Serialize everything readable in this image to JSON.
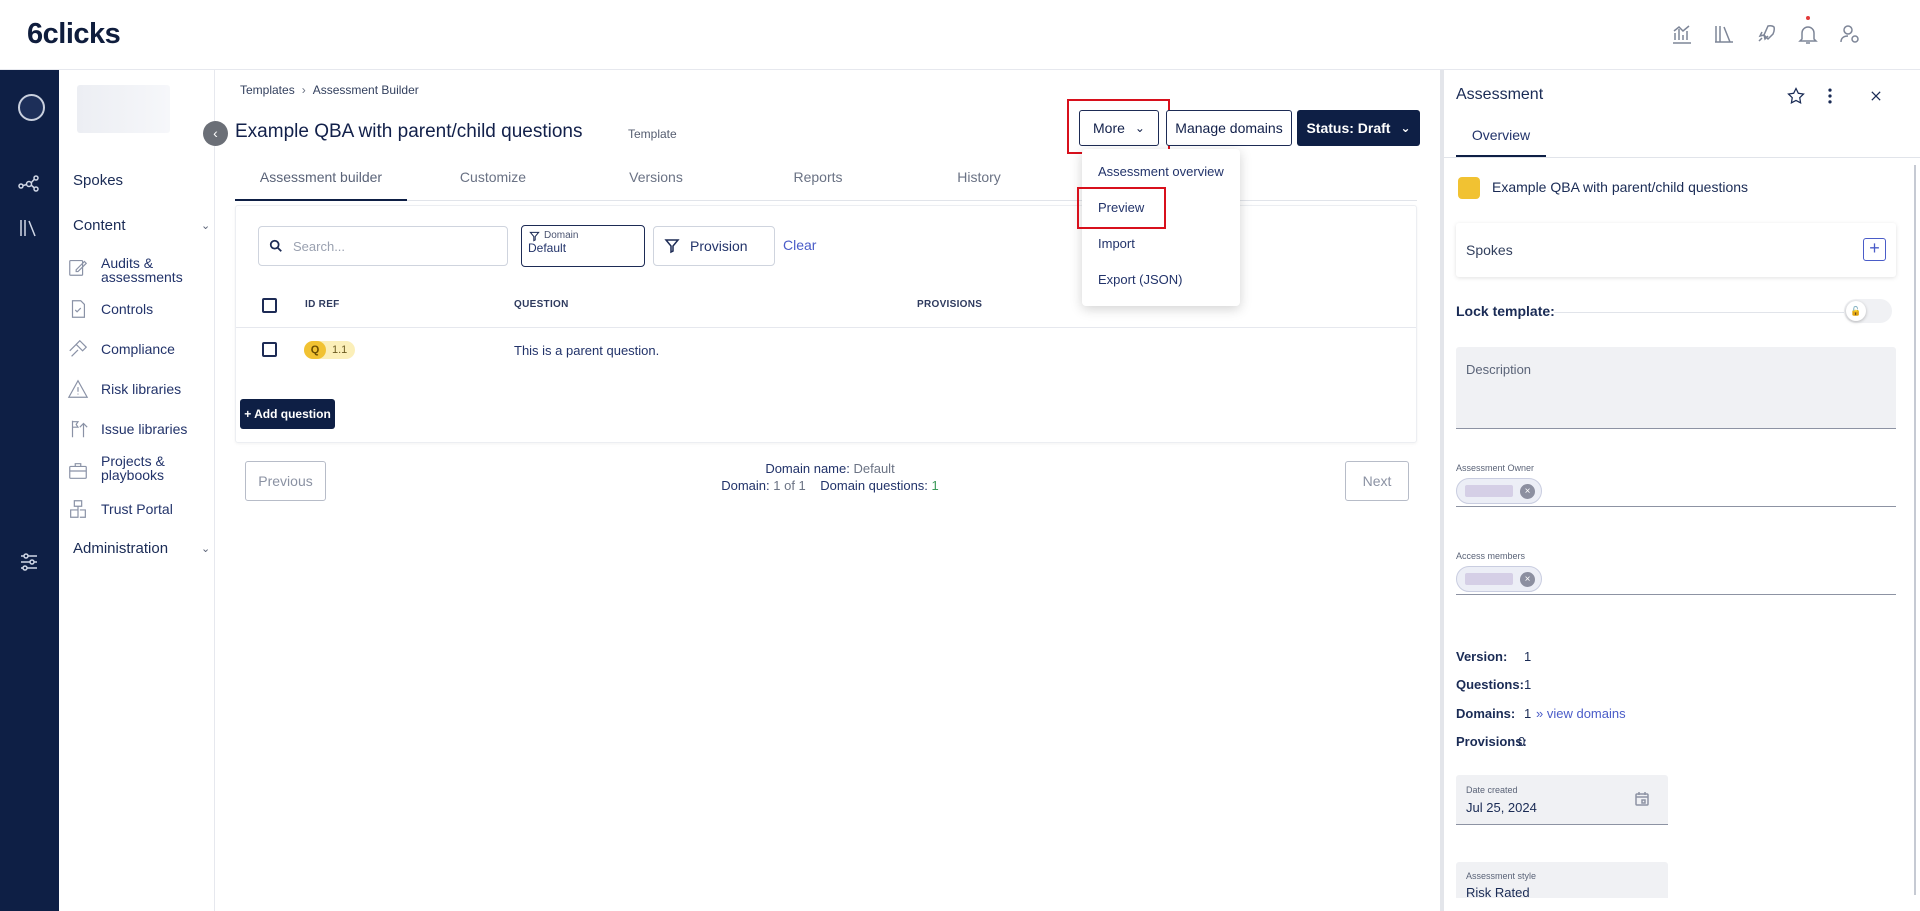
{
  "brand": {
    "logo_text": "6clicks"
  },
  "topbar": {
    "icons": [
      "analytics-icon",
      "library-icon",
      "rocket-icon",
      "bell-icon",
      "user-settings-icon"
    ]
  },
  "leftnav": {
    "spokes": "Spokes",
    "content": "Content",
    "items": [
      {
        "label": "Audits & assessments",
        "icon": "audit-icon"
      },
      {
        "label": "Controls",
        "icon": "controls-icon"
      },
      {
        "label": "Compliance",
        "icon": "compliance-icon"
      },
      {
        "label": "Risk libraries",
        "icon": "risk-icon"
      },
      {
        "label": "Issue libraries",
        "icon": "issue-icon"
      },
      {
        "label": "Projects & playbooks",
        "icon": "projects-icon"
      },
      {
        "label": "Trust Portal",
        "icon": "trust-portal-icon"
      }
    ],
    "administration": "Administration"
  },
  "breadcrumb": {
    "items": [
      "Templates",
      "Assessment Builder"
    ]
  },
  "page": {
    "title": "Example QBA with parent/child questions",
    "type": "Template"
  },
  "actions": {
    "more": "More",
    "manage_domains": "Manage domains",
    "status": "Status: Draft"
  },
  "tabs": [
    "Assessment builder",
    "Customize",
    "Versions",
    "Reports",
    "History"
  ],
  "filters": {
    "search_placeholder": "Search...",
    "domain_label": "Domain",
    "domain_value": "Default",
    "provision": "Provision",
    "clear": "Clear"
  },
  "table": {
    "headers": [
      "ID REF",
      "QUESTION",
      "PROVISIONS"
    ],
    "rows": [
      {
        "badge": "Q",
        "id": "1.1",
        "question": "This is a parent question."
      }
    ]
  },
  "add_question": "+ Add question",
  "pager": {
    "previous": "Previous",
    "next": "Next",
    "domain_name_label": "Domain name:",
    "domain_name": "Default",
    "domain_label": "Domain:",
    "domain_value": "1 of 1",
    "domain_questions_label": "Domain questions:",
    "domain_questions": "1"
  },
  "more_menu": [
    "Assessment overview",
    "Preview",
    "Import",
    "Export (JSON)"
  ],
  "right_panel": {
    "title": "Assessment",
    "tab": "Overview",
    "assessment_name": "Example QBA with parent/child questions",
    "spokes": "Spokes",
    "lock_template": "Lock template:",
    "description": "Description",
    "owner_label": "Assessment Owner",
    "members_label": "Access members",
    "version_label": "Version:",
    "version": "1",
    "questions_label": "Questions:",
    "questions": "1",
    "domains_label": "Domains:",
    "domains": "1",
    "view_domains": "» view domains",
    "provisions_label": "Provisions:",
    "provisions": "0",
    "date_created_label": "Date created",
    "date_created": "Jul 25, 2024",
    "style_label": "Assessment style",
    "style": "Risk Rated"
  },
  "colors": {
    "navy": "#0e1f45",
    "highlight": "#d8101c",
    "accent": "#4a5cc8",
    "badge": "#f1c232"
  }
}
